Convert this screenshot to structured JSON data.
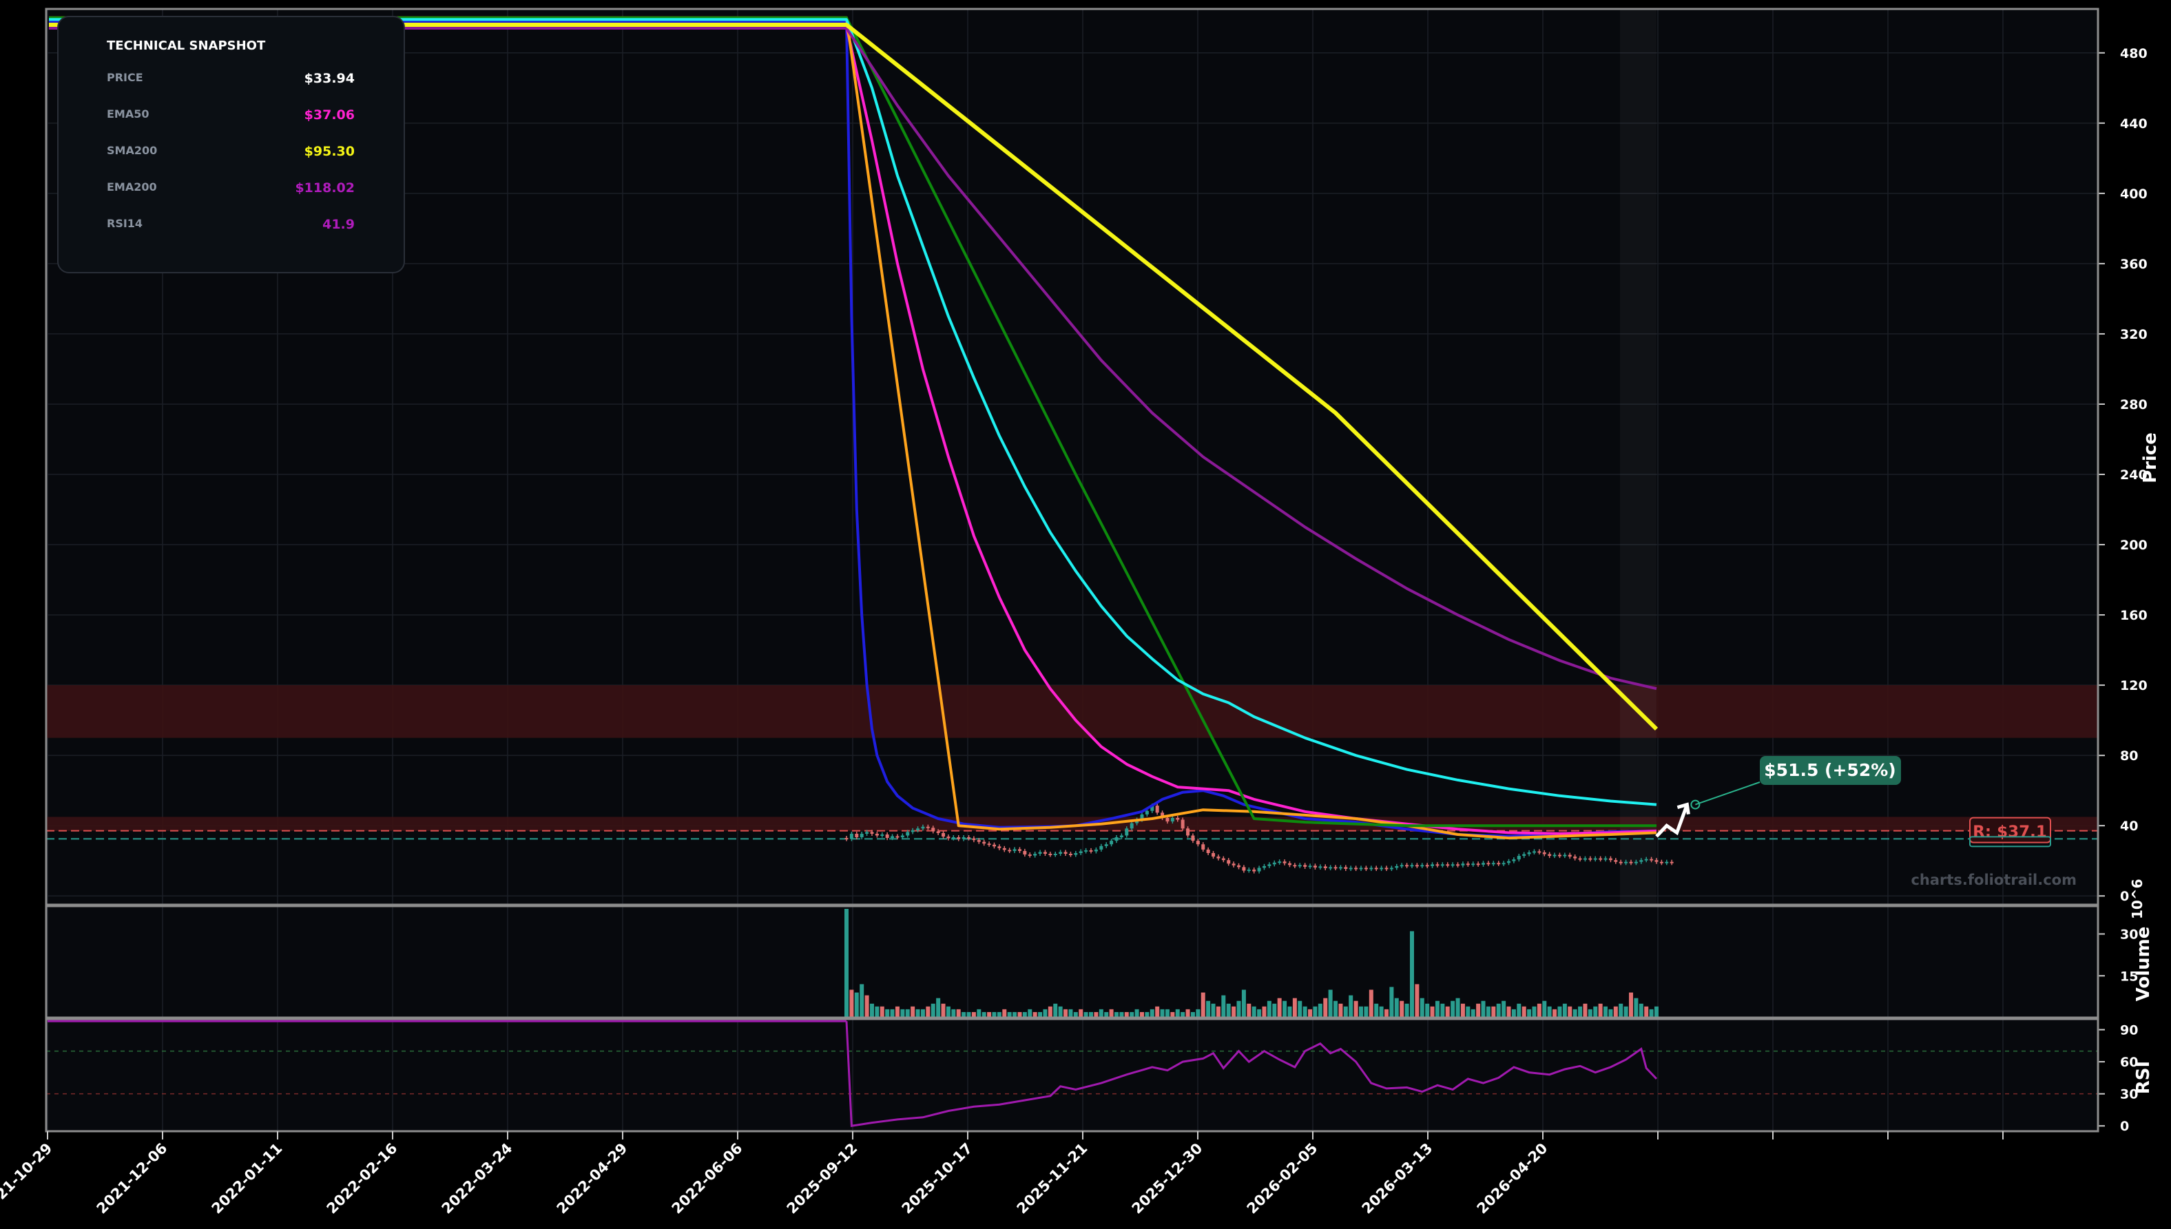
{
  "chart_data": {
    "type": "line",
    "subtype": "candlestick-with-indicators",
    "watermark": "charts.foliotrail.com",
    "x_ticks": [
      "2021-10-29",
      "2021-12-06",
      "2022-01-11",
      "2022-02-16",
      "2022-03-24",
      "2022-04-29",
      "2022-06-06",
      "2025-09-12",
      "2025-10-17",
      "2025-11-21",
      "2025-12-30",
      "2026-02-05",
      "2026-03-13",
      "2026-04-20"
    ],
    "price_panel": {
      "ylabel": "Price",
      "ylim": [
        -5,
        505
      ],
      "yticks": [
        0,
        40,
        80,
        120,
        160,
        200,
        240,
        280,
        320,
        360,
        400,
        440,
        480
      ],
      "zones": [
        {
          "from": 90,
          "to": 120,
          "color": "#3a1214"
        },
        {
          "from": 37,
          "to": 45,
          "color": "#3a1214"
        }
      ],
      "levels": [
        {
          "value": 37.1,
          "color": "#e05050",
          "label": "R: $37.1"
        },
        {
          "value": 32.5,
          "color": "#2a9d8f",
          "label": ""
        }
      ],
      "prediction": {
        "label": "$51.5 (+52%)",
        "target": 51.5
      },
      "series": [
        {
          "id": "ema20",
          "color": "#1f1fe0",
          "pre": 498,
          "points": [
            [
              0,
              498
            ],
            [
              1,
              330
            ],
            [
              2,
              220
            ],
            [
              3,
              160
            ],
            [
              4,
              120
            ],
            [
              5,
              95
            ],
            [
              6,
              80
            ],
            [
              8,
              65
            ],
            [
              10,
              57
            ],
            [
              13,
              50
            ],
            [
              18,
              44
            ],
            [
              23,
              41
            ],
            [
              30,
              39
            ],
            [
              40,
              39.5
            ],
            [
              45,
              40
            ],
            [
              52,
              44
            ],
            [
              58,
              48
            ],
            [
              62,
              55
            ],
            [
              66,
              59
            ],
            [
              70,
              60
            ],
            [
              74,
              57
            ],
            [
              78,
              52
            ],
            [
              84,
              48
            ],
            [
              90,
              44
            ],
            [
              100,
              42
            ],
            [
              110,
              38
            ],
            [
              120,
              35
            ],
            [
              130,
              34
            ],
            [
              140,
              35
            ],
            [
              150,
              36.5
            ],
            [
              159,
              37
            ]
          ]
        },
        {
          "id": "ema50",
          "color": "#ff22d0",
          "pre": 495,
          "points": [
            [
              0,
              495
            ],
            [
              5,
              430
            ],
            [
              10,
              360
            ],
            [
              15,
              300
            ],
            [
              20,
              250
            ],
            [
              25,
              205
            ],
            [
              30,
              170
            ],
            [
              35,
              140
            ],
            [
              40,
              118
            ],
            [
              45,
              100
            ],
            [
              50,
              85
            ],
            [
              55,
              75
            ],
            [
              60,
              68
            ],
            [
              65,
              62
            ],
            [
              70,
              61
            ],
            [
              75,
              60
            ],
            [
              80,
              55
            ],
            [
              90,
              48
            ],
            [
              100,
              44
            ],
            [
              110,
              41
            ],
            [
              120,
              38
            ],
            [
              130,
              36
            ],
            [
              140,
              35.5
            ],
            [
              150,
              36
            ],
            [
              159,
              37
            ]
          ]
        },
        {
          "id": "sma20",
          "color": "#ffa41c",
          "pre": 500,
          "points": [
            [
              0,
              500
            ],
            [
              22,
              40
            ],
            [
              30,
              38
            ],
            [
              40,
              39
            ],
            [
              50,
              41
            ],
            [
              60,
              44
            ],
            [
              70,
              49
            ],
            [
              80,
              48
            ],
            [
              90,
              46
            ],
            [
              100,
              44
            ],
            [
              110,
              40
            ],
            [
              120,
              35
            ],
            [
              130,
              33
            ],
            [
              140,
              34
            ],
            [
              150,
              35
            ],
            [
              159,
              36
            ]
          ]
        },
        {
          "id": "sma50",
          "color": "#0d8a0d",
          "pre": 500,
          "points": [
            [
              0,
              500
            ],
            [
              45,
              240
            ],
            [
              80,
              44
            ],
            [
              90,
              42
            ],
            [
              100,
              41
            ],
            [
              110,
              40
            ],
            [
              120,
              40
            ],
            [
              130,
              40
            ],
            [
              140,
              40
            ],
            [
              150,
              40
            ],
            [
              159,
              40
            ]
          ]
        },
        {
          "id": "ema100",
          "color": "#1ff0f0",
          "pre": 499,
          "points": [
            [
              0,
              499
            ],
            [
              5,
              460
            ],
            [
              10,
              410
            ],
            [
              15,
              370
            ],
            [
              20,
              330
            ],
            [
              25,
              295
            ],
            [
              30,
              262
            ],
            [
              35,
              233
            ],
            [
              40,
              207
            ],
            [
              45,
              185
            ],
            [
              50,
              165
            ],
            [
              55,
              148
            ],
            [
              60,
              135
            ],
            [
              65,
              123
            ],
            [
              70,
              115
            ],
            [
              75,
              110
            ],
            [
              80,
              102
            ],
            [
              90,
              90
            ],
            [
              100,
              80
            ],
            [
              110,
              72
            ],
            [
              120,
              66
            ],
            [
              130,
              61
            ],
            [
              140,
              57
            ],
            [
              150,
              54
            ],
            [
              159,
              52
            ]
          ]
        },
        {
          "id": "ema200",
          "color": "#8a1a96",
          "pre": 494,
          "points": [
            [
              0,
              494
            ],
            [
              10,
              450
            ],
            [
              20,
              410
            ],
            [
              30,
              375
            ],
            [
              40,
              340
            ],
            [
              50,
              305
            ],
            [
              60,
              275
            ],
            [
              70,
              250
            ],
            [
              80,
              230
            ],
            [
              90,
              210
            ],
            [
              100,
              192
            ],
            [
              110,
              175
            ],
            [
              120,
              160
            ],
            [
              130,
              146
            ],
            [
              140,
              134
            ],
            [
              150,
              124
            ],
            [
              159,
              118
            ]
          ]
        },
        {
          "id": "sma200",
          "color": "#f5f516",
          "pre": 496,
          "points": [
            [
              0,
              496
            ],
            [
              96,
              275
            ],
            [
              159,
              95
            ]
          ]
        }
      ],
      "candles": {
        "start_close": 33,
        "moves": [
          0,
          3,
          -2,
          2,
          1,
          -1,
          -1,
          0,
          -2,
          1,
          0,
          1,
          2,
          1,
          1,
          1,
          0,
          -2,
          -1,
          -2,
          -1,
          0,
          -1,
          1,
          0,
          -1,
          -1,
          -1,
          0,
          -1,
          -1,
          -1,
          0,
          1,
          -1,
          -2,
          0,
          1,
          1,
          -1,
          0,
          0,
          1,
          -1,
          0,
          1,
          1,
          0,
          0,
          1,
          2,
          1,
          2,
          2,
          1,
          4,
          3,
          2,
          3,
          2,
          3,
          -4,
          -3,
          -2,
          2,
          -1,
          -5,
          -4,
          -3,
          -2,
          -3,
          -2,
          -2,
          -1,
          -1,
          -2,
          -1,
          -1,
          -2,
          0,
          -1,
          2,
          1,
          1,
          1,
          0,
          -1,
          -1,
          0,
          0,
          -1,
          0,
          -1,
          0,
          -1,
          0,
          0,
          0,
          -1,
          0,
          0,
          0,
          0,
          0,
          0,
          0,
          0,
          0,
          1,
          0,
          0,
          0,
          0,
          0,
          0,
          1,
          0,
          0,
          0,
          0,
          0,
          1,
          0,
          0,
          0,
          1,
          0,
          0,
          0,
          0,
          1,
          1,
          2,
          1,
          1,
          0,
          0,
          -1,
          -1,
          0,
          0,
          0,
          -1,
          -1,
          0,
          0,
          0,
          0,
          0,
          0,
          -1,
          -1,
          0,
          0,
          0,
          0,
          1,
          0,
          0,
          -1,
          0,
          0,
          0
        ]
      },
      "forecast": [
        [
          159,
          33.9
        ],
        [
          161,
          40
        ],
        [
          163,
          36
        ],
        [
          165,
          52
        ]
      ]
    },
    "volume_panel": {
      "ylabel": "Volume",
      "units": "10^6",
      "yticks": [
        15,
        30
      ],
      "ylim": [
        0,
        40
      ],
      "values": [
        39,
        10,
        9,
        12,
        8,
        5,
        4,
        4,
        3,
        3,
        4,
        3,
        3,
        4,
        3,
        3,
        4,
        5,
        7,
        5,
        4,
        3,
        3,
        2,
        2,
        2,
        3,
        2,
        2,
        2,
        2,
        3,
        2,
        2,
        2,
        2,
        3,
        2,
        2,
        3,
        4,
        5,
        4,
        3,
        3,
        2,
        3,
        2,
        2,
        2,
        3,
        2,
        3,
        2,
        2,
        2,
        2,
        3,
        2,
        2,
        3,
        4,
        3,
        3,
        2,
        3,
        2,
        3,
        2,
        3,
        9,
        6,
        5,
        4,
        8,
        5,
        4,
        6,
        10,
        5,
        4,
        3,
        4,
        6,
        5,
        7,
        6,
        4,
        7,
        6,
        4,
        3,
        4,
        5,
        7,
        10,
        6,
        5,
        4,
        8,
        6,
        4,
        4,
        10,
        5,
        4,
        3,
        11,
        7,
        6,
        5,
        31,
        12,
        7,
        5,
        4,
        6,
        5,
        4,
        6,
        7,
        5,
        4,
        3,
        5,
        6,
        4,
        4,
        5,
        6,
        4,
        3,
        5,
        4,
        3,
        4,
        5,
        6,
        4,
        3,
        4,
        5,
        4,
        3,
        4,
        5,
        3,
        4,
        5,
        4,
        3,
        4,
        5,
        4,
        9,
        7,
        5,
        4,
        3,
        4
      ]
    },
    "rsi_panel": {
      "ylabel": "RSI",
      "yticks": [
        0,
        30,
        60,
        90
      ],
      "ylim": [
        -5,
        100
      ],
      "pre": 98,
      "points": [
        [
          0,
          98
        ],
        [
          1,
          0
        ],
        [
          5,
          3
        ],
        [
          10,
          6
        ],
        [
          15,
          8
        ],
        [
          20,
          14
        ],
        [
          25,
          18
        ],
        [
          30,
          20
        ],
        [
          35,
          24
        ],
        [
          40,
          28
        ],
        [
          42,
          37
        ],
        [
          45,
          34
        ],
        [
          50,
          40
        ],
        [
          55,
          48
        ],
        [
          60,
          55
        ],
        [
          63,
          52
        ],
        [
          66,
          60
        ],
        [
          70,
          63
        ],
        [
          72,
          68
        ],
        [
          74,
          54
        ],
        [
          77,
          70
        ],
        [
          79,
          60
        ],
        [
          82,
          70
        ],
        [
          85,
          62
        ],
        [
          88,
          55
        ],
        [
          90,
          70
        ],
        [
          93,
          77
        ],
        [
          95,
          68
        ],
        [
          97,
          72
        ],
        [
          100,
          60
        ],
        [
          103,
          40
        ],
        [
          106,
          35
        ],
        [
          110,
          36
        ],
        [
          113,
          32
        ],
        [
          116,
          38
        ],
        [
          119,
          34
        ],
        [
          122,
          44
        ],
        [
          125,
          40
        ],
        [
          128,
          45
        ],
        [
          131,
          55
        ],
        [
          134,
          50
        ],
        [
          138,
          48
        ],
        [
          141,
          53
        ],
        [
          144,
          56
        ],
        [
          147,
          50
        ],
        [
          150,
          55
        ],
        [
          153,
          62
        ],
        [
          156,
          72
        ],
        [
          157,
          54
        ],
        [
          159,
          44
        ]
      ]
    }
  },
  "snapshot": {
    "title": "TECHNICAL SNAPSHOT",
    "rows": [
      {
        "label": "PRICE",
        "value": "$33.94",
        "color": "#ffffff"
      },
      {
        "label": "EMA50",
        "value": "$37.06",
        "color": "#ff22d0"
      },
      {
        "label": "SMA200",
        "value": "$95.30",
        "color": "#f5f516"
      },
      {
        "label": "EMA200",
        "value": "$118.02",
        "color": "#b01cbc"
      },
      {
        "label": "RSI14",
        "value": "41.9",
        "color": "#b01cbc"
      }
    ]
  },
  "colors": {
    "background": "#000000",
    "panel_bg": "#07090d",
    "axis": "#9a9a9a",
    "text": "#ffffff",
    "up": "#2a9d8f",
    "down": "#e07070",
    "rsi": "#a01aae",
    "badge_bg": "#1f6b55"
  }
}
